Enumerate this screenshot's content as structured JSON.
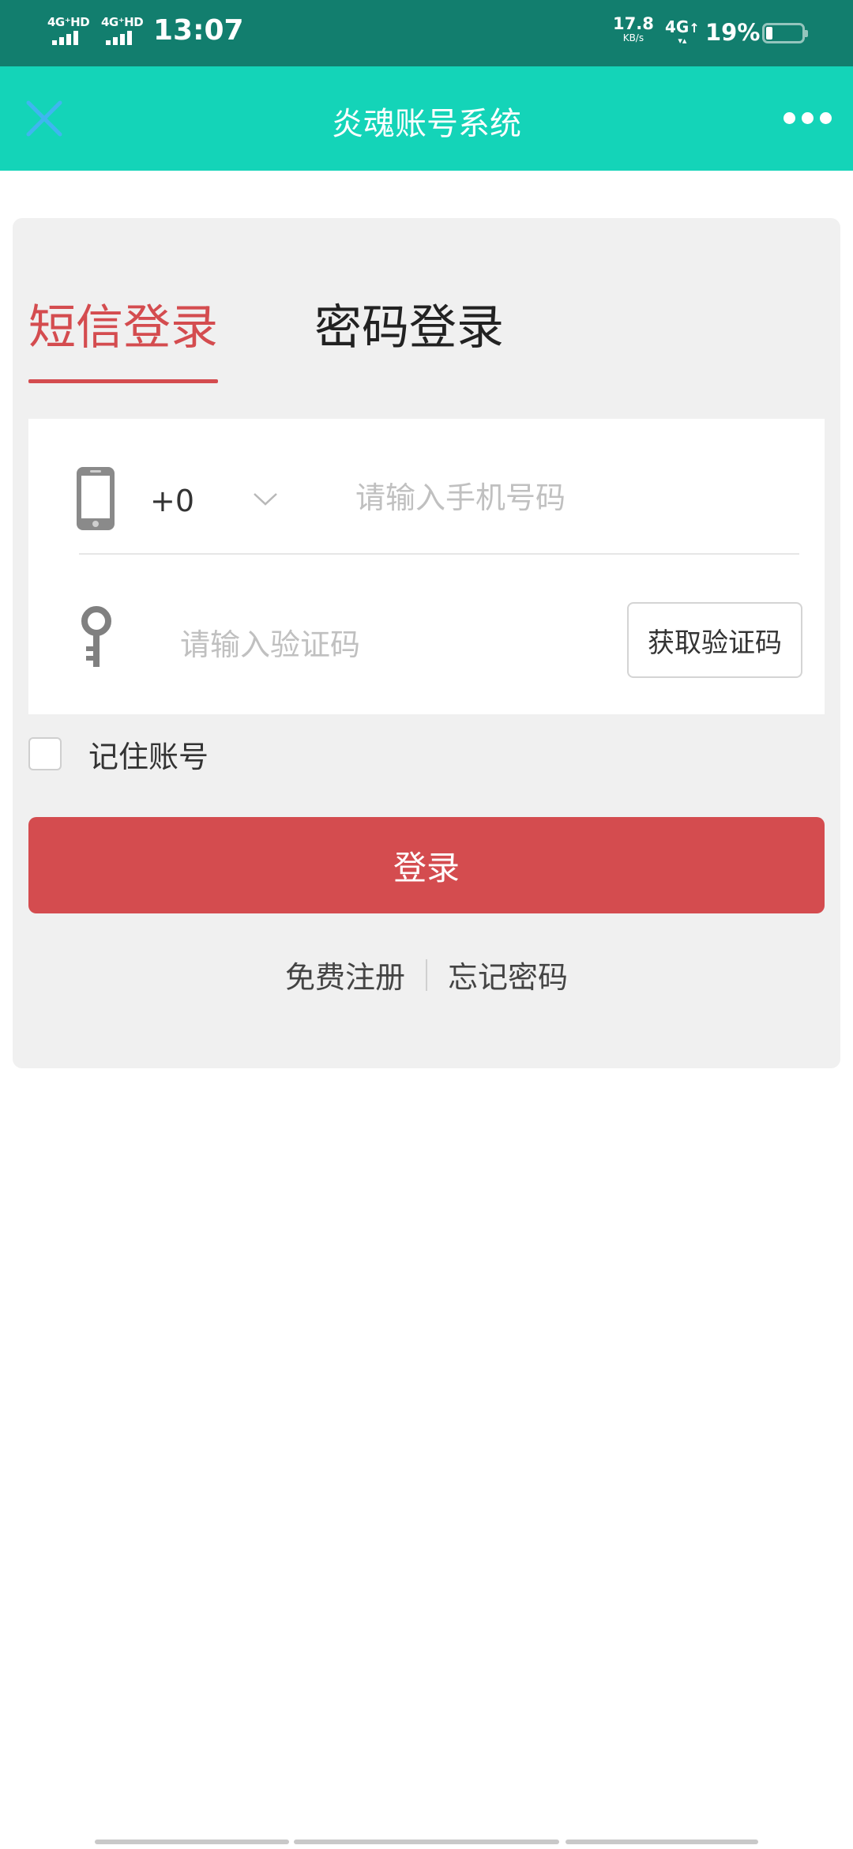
{
  "status_bar": {
    "sim1_label": "4G⁺HD",
    "sim2_label": "4G⁺HD",
    "time": "13:07",
    "net_speed_value": "17.8",
    "net_speed_unit": "KB/s",
    "net_type": "4G",
    "battery_percent": "19%",
    "battery_level": 0.19
  },
  "title_bar": {
    "title": "炎魂账号系统",
    "close_icon": "close-icon",
    "more_icon": "more-dots-icon",
    "accent_color": "#14d4b8"
  },
  "tabs": {
    "sms_login": "短信登录",
    "password_login": "密码登录",
    "active": "sms_login",
    "active_color": "#d44c4f"
  },
  "form": {
    "country_code": "+0",
    "phone_placeholder": "请输入手机号码",
    "code_placeholder": "请输入验证码",
    "get_code_label": "获取验证码",
    "phone_icon": "phone-icon",
    "key_icon": "key-icon"
  },
  "remember": {
    "label": "记住账号",
    "checked": false
  },
  "login_button": {
    "label": "登录",
    "color": "#d44c4f"
  },
  "links": {
    "register": "免费注册",
    "forgot_password": "忘记密码"
  }
}
